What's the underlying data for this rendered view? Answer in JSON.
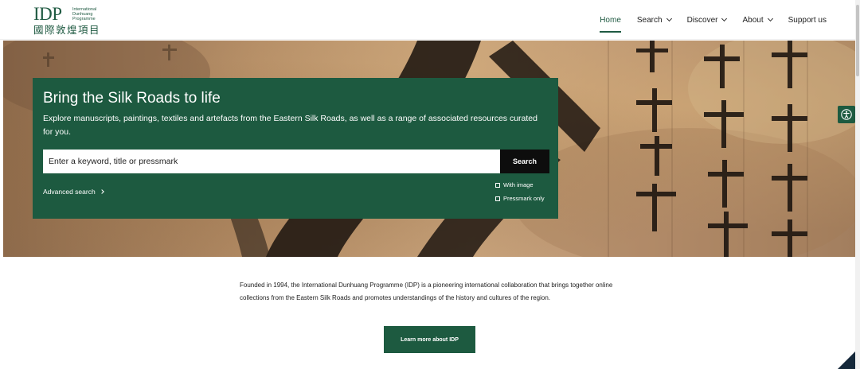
{
  "header": {
    "logo": {
      "mark": "IDP",
      "subtitle_lines": [
        "International",
        "Dunhuang",
        "Programme"
      ],
      "chinese": "國際敦煌項目"
    },
    "nav": [
      {
        "label": "Home",
        "active": true,
        "has_dropdown": false
      },
      {
        "label": "Search",
        "active": false,
        "has_dropdown": true
      },
      {
        "label": "Discover",
        "active": false,
        "has_dropdown": true
      },
      {
        "label": "About",
        "active": false,
        "has_dropdown": true
      },
      {
        "label": "Support us",
        "active": false,
        "has_dropdown": false
      }
    ]
  },
  "hero": {
    "title": "Bring the Silk Roads to life",
    "description": "Explore manuscripts, paintings, textiles and artefacts from the Eastern Silk Roads, as well as a range of associated resources curated for you.",
    "search": {
      "placeholder": "Enter a keyword, title or pressmark",
      "value": "",
      "button_label": "Search"
    },
    "advanced_search_label": "Advanced search",
    "options": [
      {
        "label": "With image",
        "checked": false
      },
      {
        "label": "Pressmark only",
        "checked": false
      }
    ]
  },
  "intro": {
    "text": "Founded in 1994, the International Dunhuang Programme (IDP) is a pioneering international collaboration that brings together online collections from the Eastern Silk Roads and promotes understandings of the history and cultures of the region.",
    "button_label": "Learn more about IDP"
  },
  "colors": {
    "brand_green": "#1d5a40",
    "search_button": "#0d0d0d"
  },
  "icons": {
    "accessibility": "accessibility-icon",
    "dropdown": "chevron-down-icon",
    "advanced_arrow": "chevron-right-icon"
  }
}
